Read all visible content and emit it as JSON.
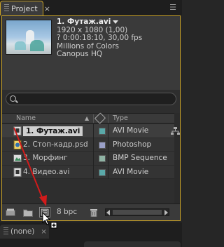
{
  "tab": {
    "label": "Project",
    "close": "×"
  },
  "panel_menu_icon": "flyout-menu-icon",
  "preview": {
    "name": "1. Футаж.avi",
    "lines": [
      "1920 x 1080 (1,00)",
      "? 0:00:18:10, 30,00 fps",
      "Millions of Colors",
      "Canopus HQ"
    ]
  },
  "columns": {
    "name": "Name",
    "type": "Type"
  },
  "items": [
    {
      "name": "1. Футаж.avi",
      "type": "AVI Movie",
      "swatch": "#5aa9a9",
      "icon": "video-file-icon",
      "selected": true
    },
    {
      "name": "2. Стоп-кадр.psd",
      "type": "Photoshop",
      "swatch": "#9aa0c8",
      "icon": "photoshop-file-icon"
    },
    {
      "name": "3. Морфинг",
      "type": "BMP Sequence",
      "swatch": "#8fb3a4",
      "icon": "image-sequence-icon"
    },
    {
      "name": "4. Видео.avi",
      "type": "AVI Movie",
      "swatch": "#5aa9a9",
      "icon": "video-file-icon"
    }
  ],
  "bottom_bar": {
    "bpc": "8 bpc"
  },
  "bottom_tab": {
    "label": "(none)",
    "close": "×"
  },
  "accent": "#c9a227",
  "arrow_color": "#d11b1b"
}
